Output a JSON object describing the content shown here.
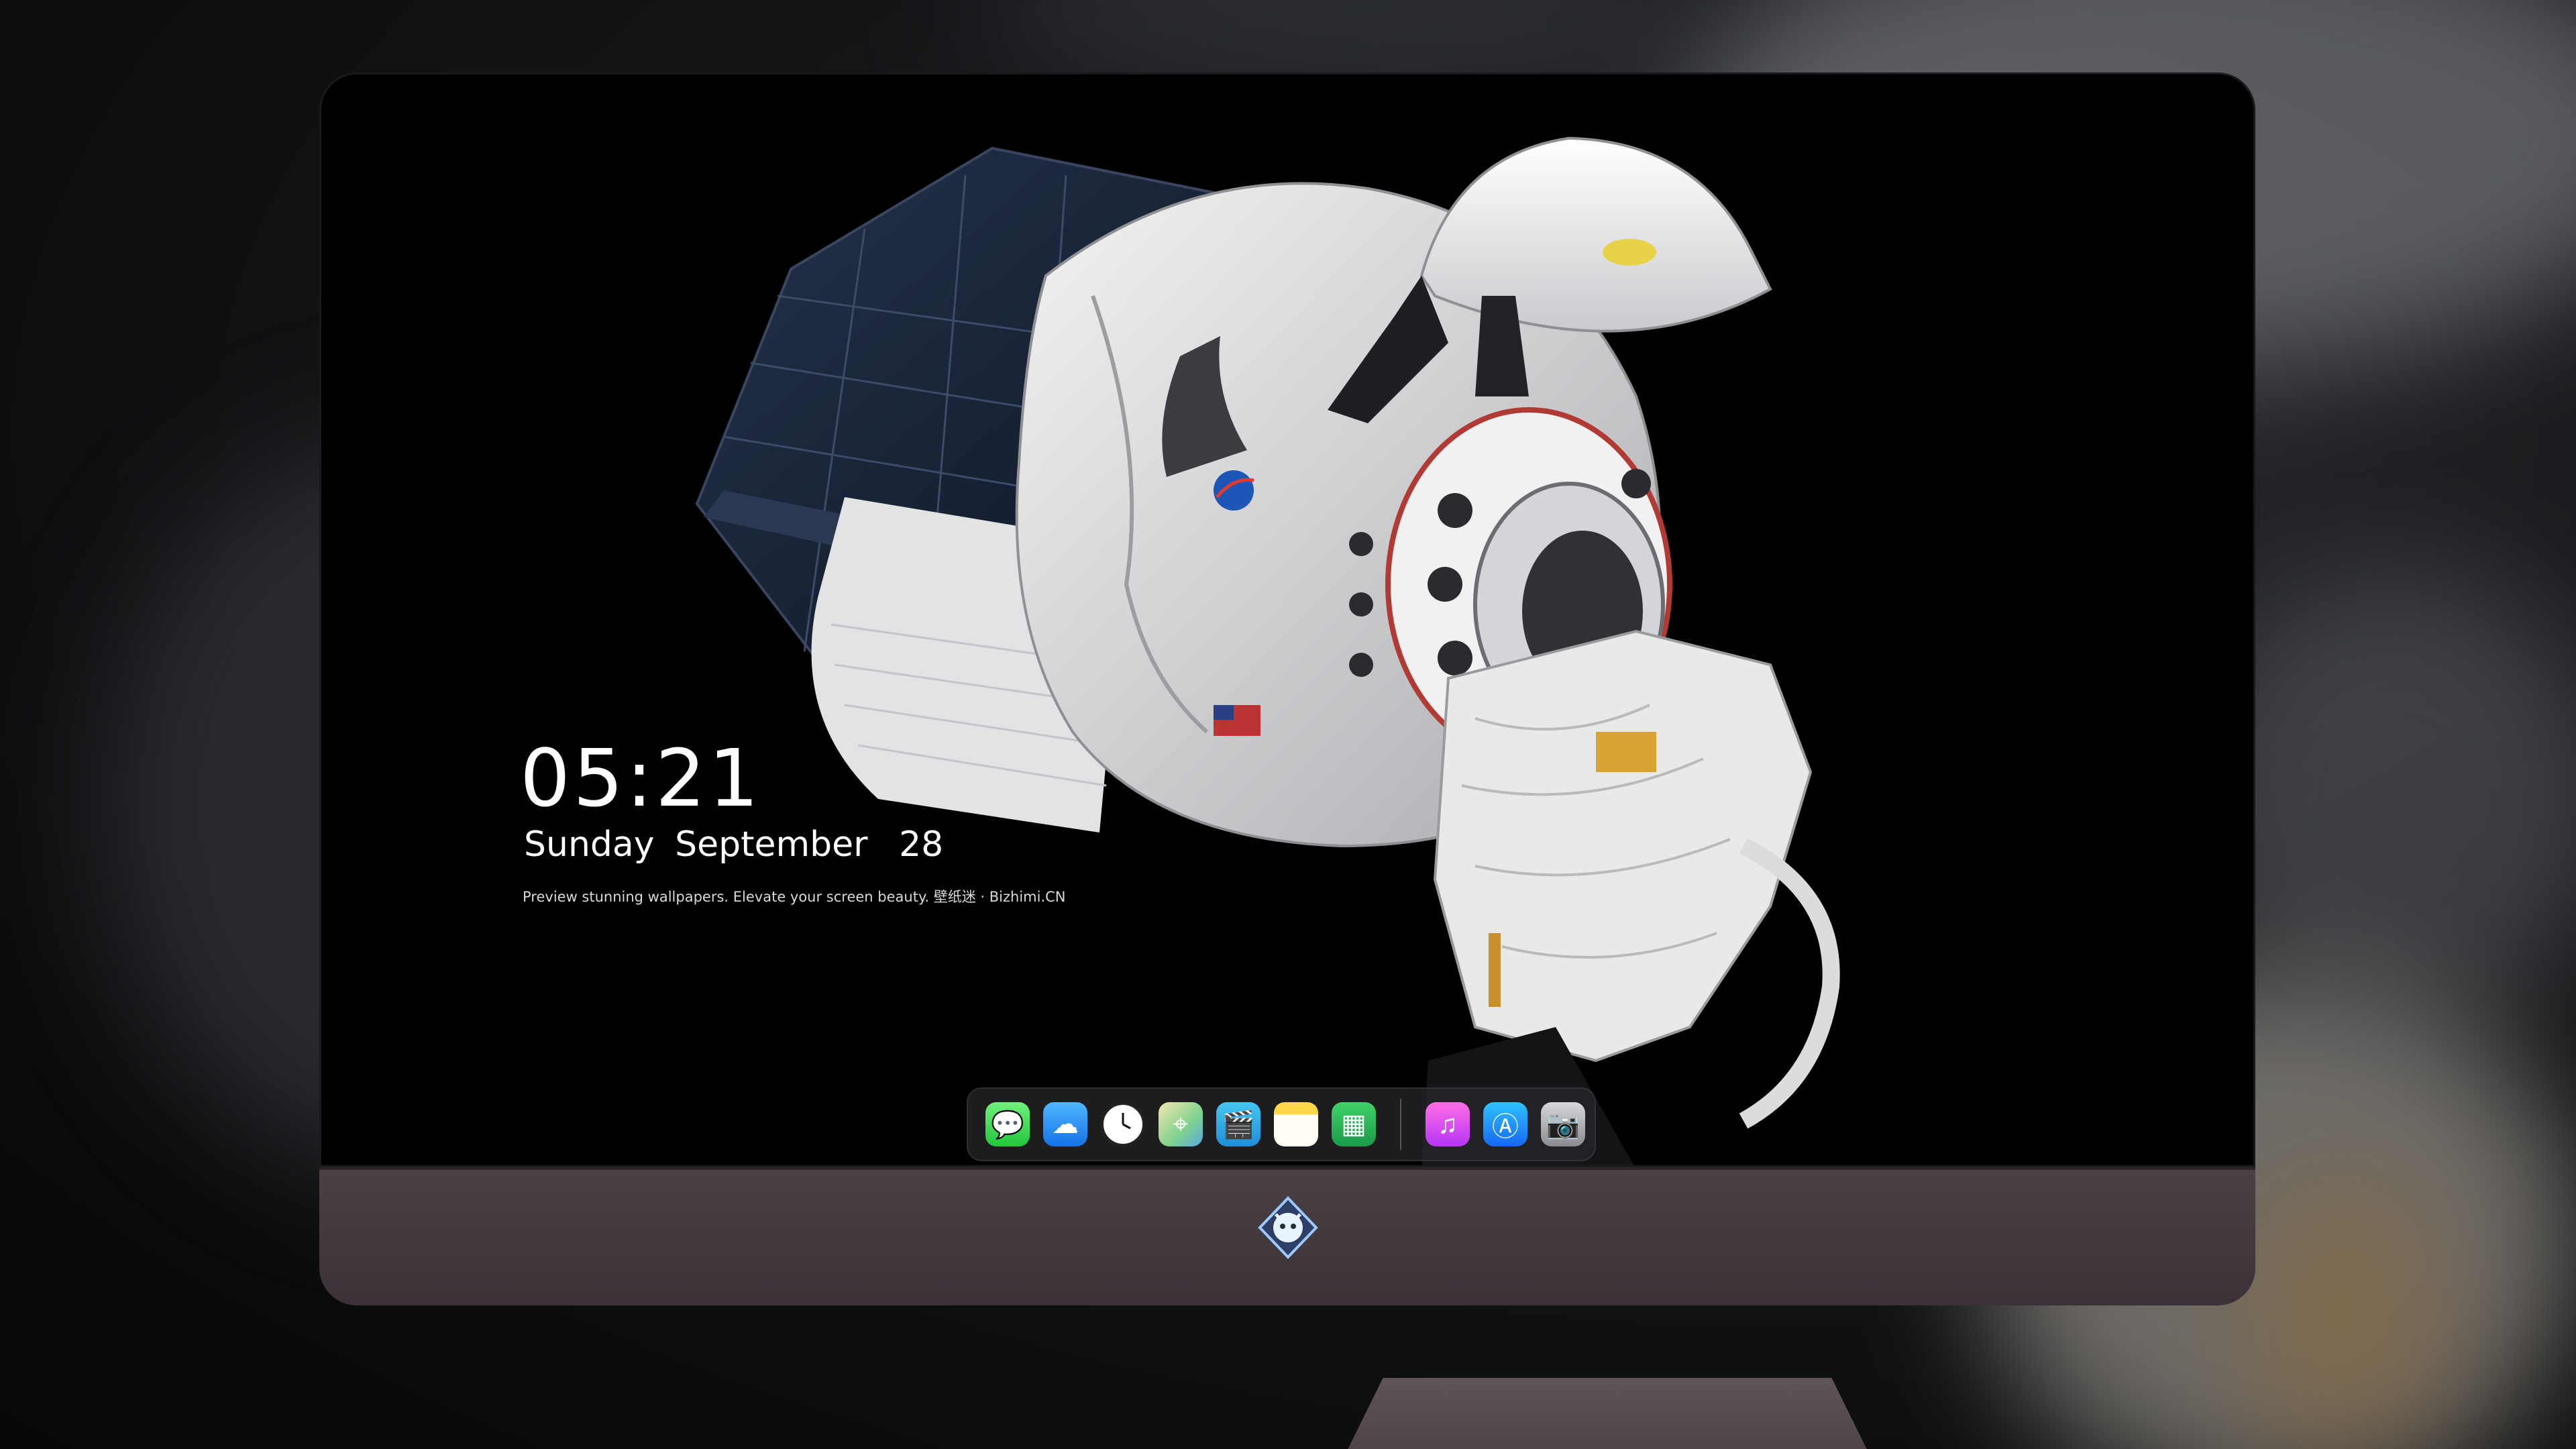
{
  "lockscreen": {
    "time": "05:21",
    "weekday": "Sunday",
    "month": "September",
    "day": "28",
    "tagline": "Preview stunning wallpapers. Elevate your screen beauty. 壁纸迷 · Bizhimi.CN"
  },
  "dock": {
    "apps": [
      {
        "name": "messages-icon",
        "glyph": "💬"
      },
      {
        "name": "weather-icon",
        "glyph": "☁"
      },
      {
        "name": "clock-icon",
        "glyph": "🕐"
      },
      {
        "name": "maps-icon",
        "glyph": "⌖"
      },
      {
        "name": "clips-icon",
        "glyph": "🎬"
      },
      {
        "name": "notes-icon",
        "glyph": ""
      },
      {
        "name": "numbers-icon",
        "glyph": "▦"
      },
      {
        "name": "itunes-icon",
        "glyph": "♫"
      },
      {
        "name": "app-store-icon",
        "glyph": "Ⓐ"
      },
      {
        "name": "camera-icon",
        "glyph": "📷"
      }
    ]
  },
  "wallpaper": {
    "subject": "space-capsule-icon"
  },
  "monitor": {
    "logo": "mascot-logo-icon"
  },
  "colors": {
    "screen_bg": "#000000",
    "chin": "#3f363b",
    "dock_bg": "#28282c"
  }
}
